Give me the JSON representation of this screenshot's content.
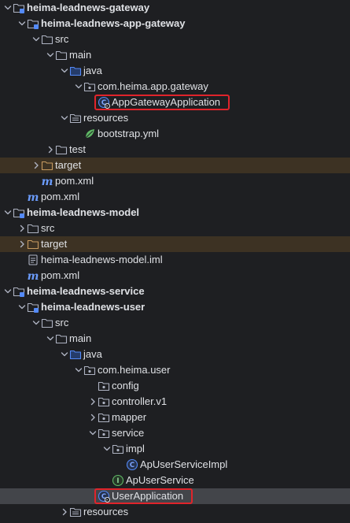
{
  "tree": [
    {
      "id": "gateway-module",
      "label": "heima-leadnews-gateway",
      "icon": "module-folder-icon",
      "expanded": true,
      "depth": 0,
      "bold": true
    },
    {
      "id": "app-gateway-module",
      "label": "heima-leadnews-app-gateway",
      "icon": "module-folder-icon",
      "expanded": true,
      "depth": 1,
      "bold": true
    },
    {
      "id": "src-folder",
      "label": "src",
      "icon": "folder-icon",
      "expanded": true,
      "depth": 2
    },
    {
      "id": "main-folder",
      "label": "main",
      "icon": "folder-icon",
      "expanded": true,
      "depth": 3
    },
    {
      "id": "java-folder",
      "label": "java",
      "icon": "source-root-icon",
      "expanded": true,
      "depth": 4
    },
    {
      "id": "package-app-gateway",
      "label": "com.heima.app.gateway",
      "icon": "package-icon",
      "expanded": true,
      "depth": 5
    },
    {
      "id": "app-gateway-application",
      "label": "AppGatewayApplication",
      "icon": "spring-boot-class-icon",
      "depth": 6,
      "highlighted": true
    },
    {
      "id": "resources-folder",
      "label": "resources",
      "icon": "resources-root-icon",
      "expanded": true,
      "depth": 4
    },
    {
      "id": "bootstrap-yml",
      "label": "bootstrap.yml",
      "icon": "spring-yaml-icon",
      "depth": 5
    },
    {
      "id": "test-folder",
      "label": "test",
      "icon": "folder-icon",
      "expanded": false,
      "depth": 3
    },
    {
      "id": "target-folder",
      "label": "target",
      "icon": "excluded-folder-icon",
      "expanded": false,
      "depth": 2,
      "excluded": true
    },
    {
      "id": "app-gateway-pom",
      "label": "pom.xml",
      "icon": "maven-icon",
      "depth": 2
    },
    {
      "id": "gateway-pom",
      "label": "pom.xml",
      "icon": "maven-icon",
      "depth": 1
    },
    {
      "id": "model-module",
      "label": "heima-leadnews-model",
      "icon": "module-folder-icon",
      "expanded": true,
      "depth": 0,
      "bold": true
    },
    {
      "id": "model-src-folder",
      "label": "src",
      "icon": "folder-icon",
      "expanded": false,
      "depth": 1
    },
    {
      "id": "model-target-folder",
      "label": "target",
      "icon": "excluded-folder-icon",
      "expanded": false,
      "depth": 1,
      "excluded": true
    },
    {
      "id": "model-iml",
      "label": "heima-leadnews-model.iml",
      "icon": "iml-file-icon",
      "depth": 1
    },
    {
      "id": "model-pom",
      "label": "pom.xml",
      "icon": "maven-icon",
      "depth": 1
    },
    {
      "id": "service-module",
      "label": "heima-leadnews-service",
      "icon": "module-folder-icon",
      "expanded": true,
      "depth": 0,
      "bold": true
    },
    {
      "id": "user-module",
      "label": "heima-leadnews-user",
      "icon": "module-folder-icon",
      "expanded": true,
      "depth": 1,
      "bold": true
    },
    {
      "id": "user-src-folder",
      "label": "src",
      "icon": "folder-icon",
      "expanded": true,
      "depth": 2
    },
    {
      "id": "user-main-folder",
      "label": "main",
      "icon": "folder-icon",
      "expanded": true,
      "depth": 3
    },
    {
      "id": "user-java-folder",
      "label": "java",
      "icon": "source-root-icon",
      "expanded": true,
      "depth": 4
    },
    {
      "id": "package-user",
      "label": "com.heima.user",
      "icon": "package-icon",
      "expanded": true,
      "depth": 5
    },
    {
      "id": "config-package",
      "label": "config",
      "icon": "package-icon",
      "depth": 6
    },
    {
      "id": "controller-package",
      "label": "controller.v1",
      "icon": "package-icon",
      "expanded": false,
      "depth": 6
    },
    {
      "id": "mapper-package",
      "label": "mapper",
      "icon": "package-icon",
      "expanded": false,
      "depth": 6
    },
    {
      "id": "service-package",
      "label": "service",
      "icon": "package-icon",
      "expanded": true,
      "depth": 6
    },
    {
      "id": "impl-package",
      "label": "impl",
      "icon": "package-icon",
      "expanded": true,
      "depth": 7
    },
    {
      "id": "ap-user-service-impl",
      "label": "ApUserServiceImpl",
      "icon": "class-icon",
      "depth": 8
    },
    {
      "id": "ap-user-service",
      "label": "ApUserService",
      "icon": "interface-icon",
      "depth": 7
    },
    {
      "id": "user-application",
      "label": "UserApplication",
      "icon": "spring-boot-class-icon",
      "depth": 6,
      "highlighted": true,
      "selected": true
    },
    {
      "id": "user-resources-folder",
      "label": "resources",
      "icon": "resources-root-icon",
      "expanded": false,
      "depth": 4
    }
  ],
  "colors": {
    "background": "#1e1f22",
    "text": "#dfe1e5",
    "selected_row": "#43454a",
    "excluded_row": "#3d3223",
    "highlight_border": "#e0242b",
    "folder": "#aeb3c2",
    "excluded_folder": "#c69a60",
    "class_icon": "#548af7",
    "interface_icon": "#5fb865",
    "maven_icon": "#6b9bfa"
  }
}
